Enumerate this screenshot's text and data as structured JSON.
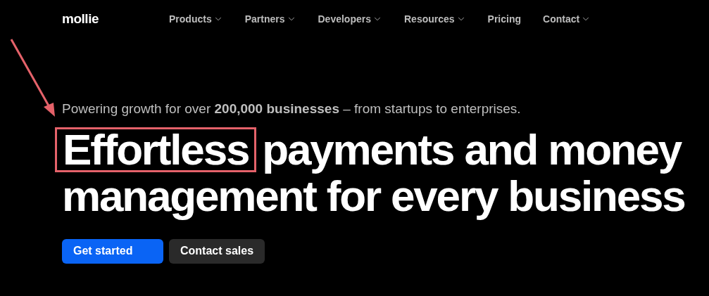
{
  "logo": "mollie",
  "nav": [
    {
      "label": "Products",
      "has_menu": true
    },
    {
      "label": "Partners",
      "has_menu": true
    },
    {
      "label": "Developers",
      "has_menu": true
    },
    {
      "label": "Resources",
      "has_menu": true
    },
    {
      "label": "Pricing",
      "has_menu": false
    },
    {
      "label": "Contact",
      "has_menu": true
    }
  ],
  "tagline": "Powering growth for over **200,000 businesses** – from startups to enterprises.",
  "headline": {
    "marked_word": "Effortless",
    "lines": [
      "payments and money",
      "management for every business"
    ]
  },
  "buttons": [
    {
      "label": "Get started",
      "kind": "primary"
    },
    {
      "label": "Contact sales",
      "kind": "secondary"
    }
  ]
}
